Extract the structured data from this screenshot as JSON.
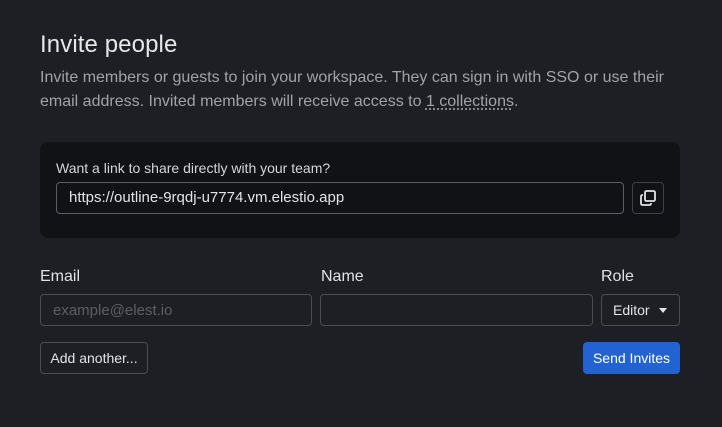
{
  "dialog": {
    "title": "Invite people",
    "description_before": "Invite members or guests to join your workspace. They can sign in with SSO or use their email address. Invited members will receive access to ",
    "description_link": "1 collections",
    "description_after": "."
  },
  "share": {
    "label": "Want a link to share directly with your team?",
    "url": "https://outline-9rqdj-u7774.vm.elestio.app",
    "copy_icon": "copy-icon"
  },
  "form": {
    "email_label": "Email",
    "email_placeholder": "example@elest.io",
    "email_value": "",
    "name_label": "Name",
    "name_value": "",
    "role_label": "Role",
    "role_value": "Editor"
  },
  "actions": {
    "add_another": "Add another...",
    "send_invites": "Send Invites"
  },
  "colors": {
    "background": "#1e1f24",
    "panel": "#111216",
    "accent": "#2363d1"
  }
}
